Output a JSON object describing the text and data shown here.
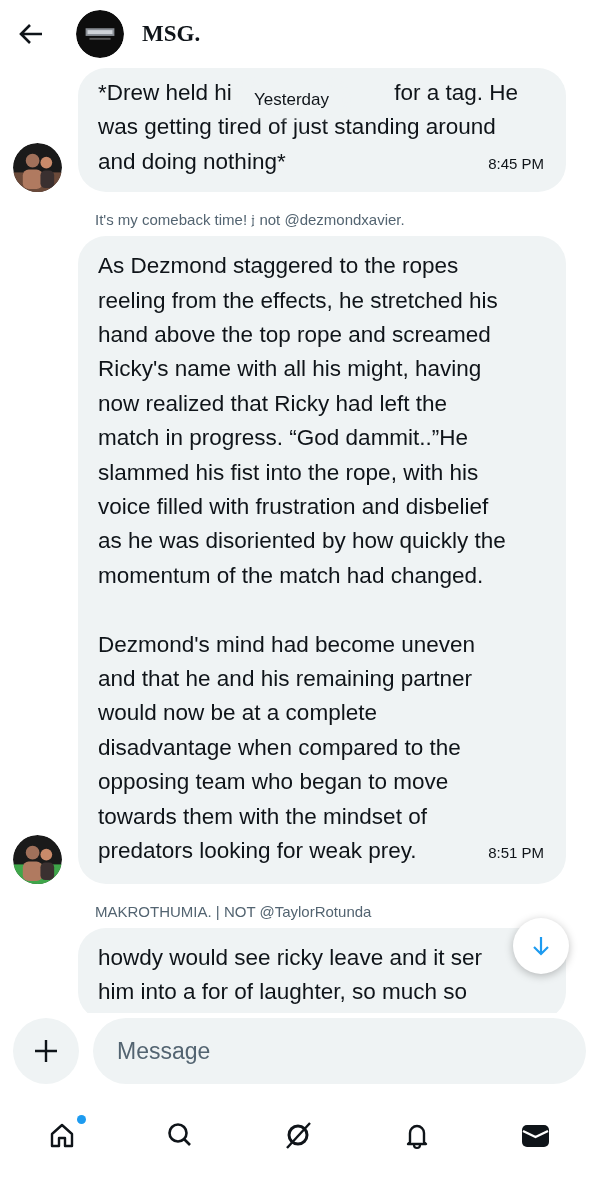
{
  "header": {
    "title": "MSG.",
    "avatar": {
      "kind": "picture"
    }
  },
  "date_pill": "Yesterday",
  "messages": [
    {
      "avatar": {
        "kind": "picture"
      },
      "first_line": [
        "*Drew held hi",
        "for a tag. He"
      ],
      "paragraphs": [
        [
          "was getting tired of just standing around",
          "and doing nothing*"
        ]
      ],
      "time": "8:45 PM"
    },
    {
      "sender": "It's my comeback time! 𝔧 not @dezmondxavier.",
      "avatar": {
        "kind": "picture"
      },
      "paragraphs": [
        [
          "As Dezmond staggered to the ropes",
          "reeling from the effects, he stretched his",
          "hand above the top rope and screamed",
          "Ricky's name with all his might, having",
          "now realized that Ricky had left the",
          "match in progress. “God dammit..”He",
          "slammed his fist into the rope, with his",
          "voice filled with frustration and disbelief",
          "as he was disoriented by how quickly the",
          "momentum of the match had changed."
        ],
        [
          "Dezmond's mind had become uneven",
          "and that he and his remaining partner",
          "would now be at a complete",
          "disadvantage when compared to the",
          "opposing team who began to move",
          "towards them with the mindset of",
          "predators looking for weak prey."
        ]
      ],
      "time": "8:51 PM"
    },
    {
      "sender": "MAKROTHUMIA. | NOT @TaylorRotunda",
      "paragraphs": [
        [
          "howdy would see ricky leave and it ser",
          "him into a for of laughter, so much so"
        ]
      ]
    }
  ],
  "composer": {
    "placeholder": "Message"
  },
  "nav": [
    {
      "kind": "home",
      "badge": true
    },
    {
      "kind": "search",
      "badge": false
    },
    {
      "kind": "grok",
      "badge": false
    },
    {
      "kind": "notifications",
      "badge": false
    },
    {
      "kind": "messages",
      "badge": false
    }
  ]
}
